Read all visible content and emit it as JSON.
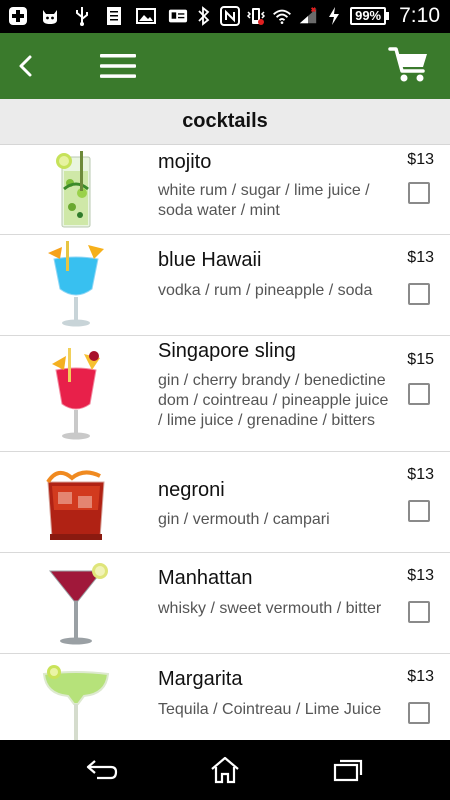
{
  "status_bar": {
    "battery": "99%",
    "time": "7:10",
    "left_icons": [
      "plus-icon",
      "cat-icon",
      "usb-icon",
      "document-icon",
      "image-icon",
      "id-card-icon"
    ],
    "right_icons": [
      "bluetooth-icon",
      "nfc-icon",
      "vibrate-icon",
      "wifi-icon",
      "signal-icon",
      "charging-icon"
    ]
  },
  "app_bar": {
    "color": "#3a7a2c",
    "icons": [
      "back-chevron-icon",
      "hamburger-menu-icon",
      "shopping-cart-icon"
    ]
  },
  "section": {
    "title": "cocktails"
  },
  "items": [
    {
      "name": "mojito",
      "ingredients": "white rum / sugar / lime juice / soda water / mint",
      "price": "$13",
      "checked": false,
      "drink_icon": "mojito-glass-icon"
    },
    {
      "name": "blue Hawaii",
      "ingredients": "vodka / rum / pineapple / soda",
      "price": "$13",
      "checked": false,
      "drink_icon": "blue-hawaii-glass-icon"
    },
    {
      "name": "Singapore sling",
      "ingredients": "gin / cherry brandy / benedictine dom / cointreau / pineapple juice / lime juice / grenadine / bitters",
      "price": "$15",
      "checked": false,
      "drink_icon": "singapore-sling-glass-icon"
    },
    {
      "name": "negroni",
      "ingredients": "gin / vermouth / campari",
      "price": "$13",
      "checked": false,
      "drink_icon": "negroni-glass-icon"
    },
    {
      "name": "Manhattan",
      "ingredients": "whisky / sweet vermouth / bitter",
      "price": "$13",
      "checked": false,
      "drink_icon": "manhattan-glass-icon"
    },
    {
      "name": "Margarita",
      "ingredients": "Tequila / Cointreau / Lime Juice",
      "price": "$13",
      "checked": false,
      "drink_icon": "margarita-glass-icon"
    }
  ],
  "nav_bar": {
    "icons": [
      "back-icon",
      "home-icon",
      "recent-apps-icon"
    ]
  }
}
